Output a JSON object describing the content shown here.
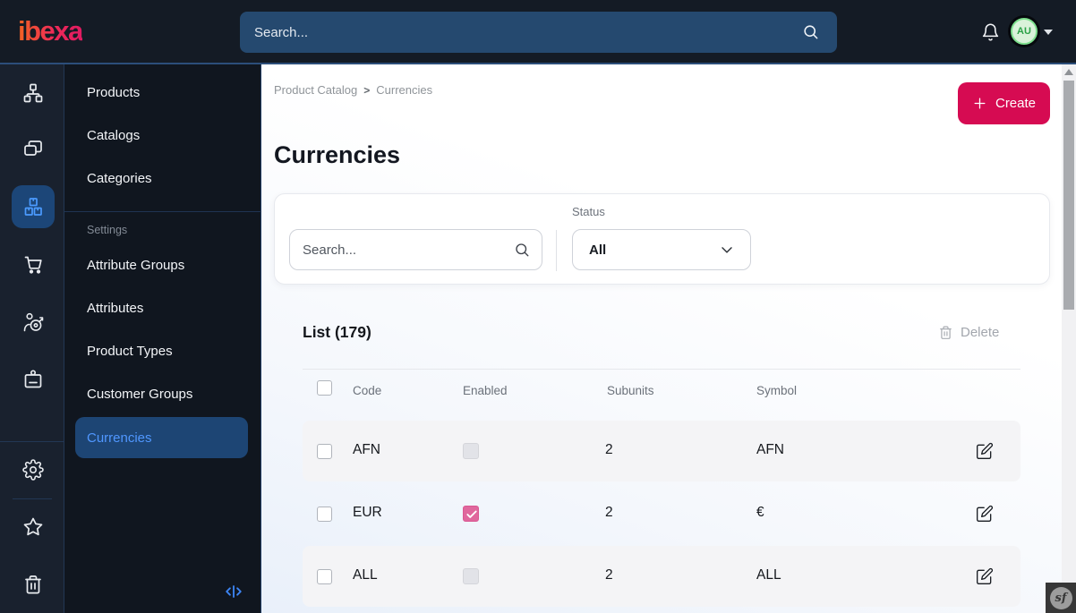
{
  "topbar": {
    "logo_text": "ibexa",
    "search_placeholder": "Search...",
    "avatar_initials": "AU"
  },
  "iconbar": {
    "icons": [
      "content-tree-icon",
      "pages-icon",
      "product-catalog-icon",
      "cart-icon",
      "personalization-icon",
      "customer-badge-icon",
      "settings-gear-icon",
      "bookmarks-star-icon",
      "trash-bin-icon"
    ],
    "active_icon": "product-catalog-icon"
  },
  "sidebar": {
    "items": [
      "Products",
      "Catalogs",
      "Categories"
    ],
    "section_label": "Settings",
    "settings_items": [
      "Attribute Groups",
      "Attributes",
      "Product Types",
      "Customer Groups",
      "Currencies"
    ],
    "active_item": "Currencies"
  },
  "breadcrumb": {
    "parent": "Product Catalog",
    "separator": ">",
    "current": "Currencies"
  },
  "page": {
    "title": "Currencies",
    "create_button": "Create"
  },
  "filterbar": {
    "search_placeholder": "Search...",
    "status_label": "Status",
    "status_value": "All"
  },
  "list": {
    "title": "List (179)",
    "delete_button": "Delete",
    "columns": [
      "Code",
      "Enabled",
      "Subunits",
      "Symbol"
    ],
    "rows": [
      {
        "code": "AFN",
        "enabled": false,
        "subunits": "2",
        "symbol": "AFN"
      },
      {
        "code": "EUR",
        "enabled": true,
        "subunits": "2",
        "symbol": "€"
      },
      {
        "code": "ALL",
        "enabled": false,
        "subunits": "2",
        "symbol": "ALL"
      }
    ]
  },
  "footer": {
    "profiler_logo": "sf"
  },
  "colors": {
    "accent_pink": "#d60b52",
    "active_blue": "#4b9bff",
    "checked_checkbox_pink": "#e0679d",
    "topbar_bg": "#141b25",
    "selected_pill_bg": "#1d4574"
  }
}
